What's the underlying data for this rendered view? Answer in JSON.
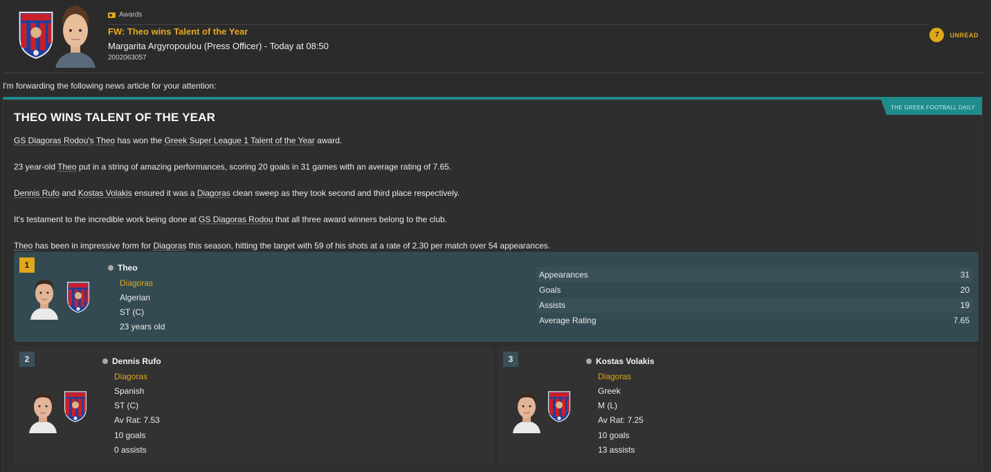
{
  "header": {
    "category": "Awards",
    "subject": "FW: Theo wins Talent of the Year",
    "sender": "Margarita Argyropoulou (Press Officer) - Today at 08:50",
    "message_id": "2002063057",
    "unread_count": "7",
    "unread_label": "UNREAD"
  },
  "intro": "I'm forwarding the following news article for your attention:",
  "article": {
    "source": "THE GREEK FOOTBALL DAILY",
    "headline": "THEO WINS TALENT OF THE YEAR",
    "p1": {
      "a": "GS Diagoras Rodou's",
      "b": " ",
      "c": "Theo",
      "d": " has won the ",
      "e": "Greek Super League 1 Talent of the Year",
      "f": " award."
    },
    "p2": {
      "a": "23 year-old ",
      "b": "Theo",
      "c": " put in a string of amazing performances, scoring 20 goals in 31 games with an average rating of 7.65."
    },
    "p3": {
      "a": "Dennis Rufo",
      "b": " and ",
      "c": "Kostas Volakis",
      "d": " ensured it was a ",
      "e": "Diagoras",
      "f": " clean sweep as they took second and third place respectively."
    },
    "p4": {
      "a": "It's testament to the incredible work being done at ",
      "b": "GS Diagoras Rodou",
      "c": " that all three award winners belong to the club."
    },
    "p5": {
      "a": "Theo",
      "b": " has been in impressive form for ",
      "c": "Diagoras",
      "d": " this season, hitting the target with 59 of his shots at a rate of 2.30 per match over 54 appearances."
    }
  },
  "winners": [
    {
      "rank": "1",
      "name": "Theo",
      "club": "Diagoras",
      "nationality": "Algerian",
      "position": "ST (C)",
      "age": "23 years old",
      "stats": [
        {
          "label": "Appearances",
          "value": "31"
        },
        {
          "label": "Goals",
          "value": "20"
        },
        {
          "label": "Assists",
          "value": "19"
        },
        {
          "label": "Average Rating",
          "value": "7.65"
        }
      ]
    },
    {
      "rank": "2",
      "name": "Dennis Rufo",
      "club": "Diagoras",
      "nationality": "Spanish",
      "position": "ST (C)",
      "rating": "Av Rat: 7.53",
      "goals": "10 goals",
      "assists": "0 assists"
    },
    {
      "rank": "3",
      "name": "Kostas Volakis",
      "club": "Diagoras",
      "nationality": "Greek",
      "position": "M (L)",
      "rating": "Av Rat: 7.25",
      "goals": "10 goals",
      "assists": "13 assists"
    }
  ],
  "colors": {
    "accent": "#e0a81a",
    "teal": "#1f8c8c",
    "card_highlight": "#344a52"
  },
  "icons": [
    "club-crest-icon",
    "awards-icon",
    "person-icon"
  ]
}
